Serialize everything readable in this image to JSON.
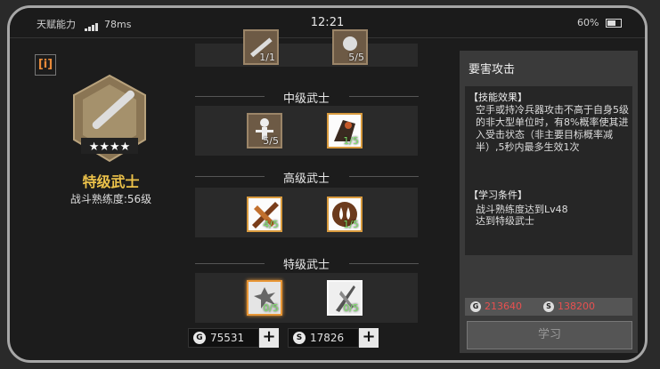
{
  "status_bar": {
    "carrier": "天赋能力",
    "ping": "78ms",
    "time": "12:21",
    "battery": "60%"
  },
  "left_panel": {
    "info_button": "[i]",
    "rank_name": "特级武士",
    "proficiency": "战斗熟练度:56级"
  },
  "tiers": [
    {
      "title": "",
      "skills": [
        {
          "icon": "bat-skill-icon",
          "level": "1/1",
          "style": "normal"
        },
        {
          "icon": "strike-skill-icon",
          "level": "5/5",
          "style": "normal"
        }
      ]
    },
    {
      "title": "中级武士",
      "skills": [
        {
          "icon": "skeleton-skill-icon",
          "level": "5/5",
          "style": "normal"
        },
        {
          "icon": "fighter-skill-icon",
          "level": "1/5",
          "style": "green"
        }
      ]
    },
    {
      "title": "高级武士",
      "skills": [
        {
          "icon": "slash-skill-icon",
          "level": "4/5",
          "style": "green"
        },
        {
          "icon": "drops-skill-icon",
          "level": "1/5",
          "style": "green"
        }
      ]
    },
    {
      "title": "特级武士",
      "skills": [
        {
          "icon": "impact-skill-icon",
          "level": "0/5",
          "style": "selected"
        },
        {
          "icon": "blade-skill-icon",
          "level": "0/5",
          "style": "locked"
        }
      ]
    }
  ],
  "currency": {
    "gold": "75531",
    "silver": "17826",
    "gold_icon": "G",
    "silver_icon": "S",
    "plus": "+"
  },
  "detail": {
    "skill_name": "要害攻击",
    "effect_header": "【技能效果】",
    "effect_text": "空手或持冷兵器攻击不高于自身5级的非大型单位时，有8%概率使其进入受击状态（非主要目标概率减半）,5秒内最多生效1次",
    "condition_header": "【学习条件】",
    "condition_lines": [
      "战斗熟练度达到Lv48",
      "达到特级武士"
    ],
    "cost_gold": "213640",
    "cost_silver": "138200",
    "learn_button": "学习"
  },
  "colors": {
    "rank_gold": "#ecc24a",
    "cost_red": "#e85050",
    "level_green": "#7ee06a",
    "selected_orange": "#e89636"
  }
}
